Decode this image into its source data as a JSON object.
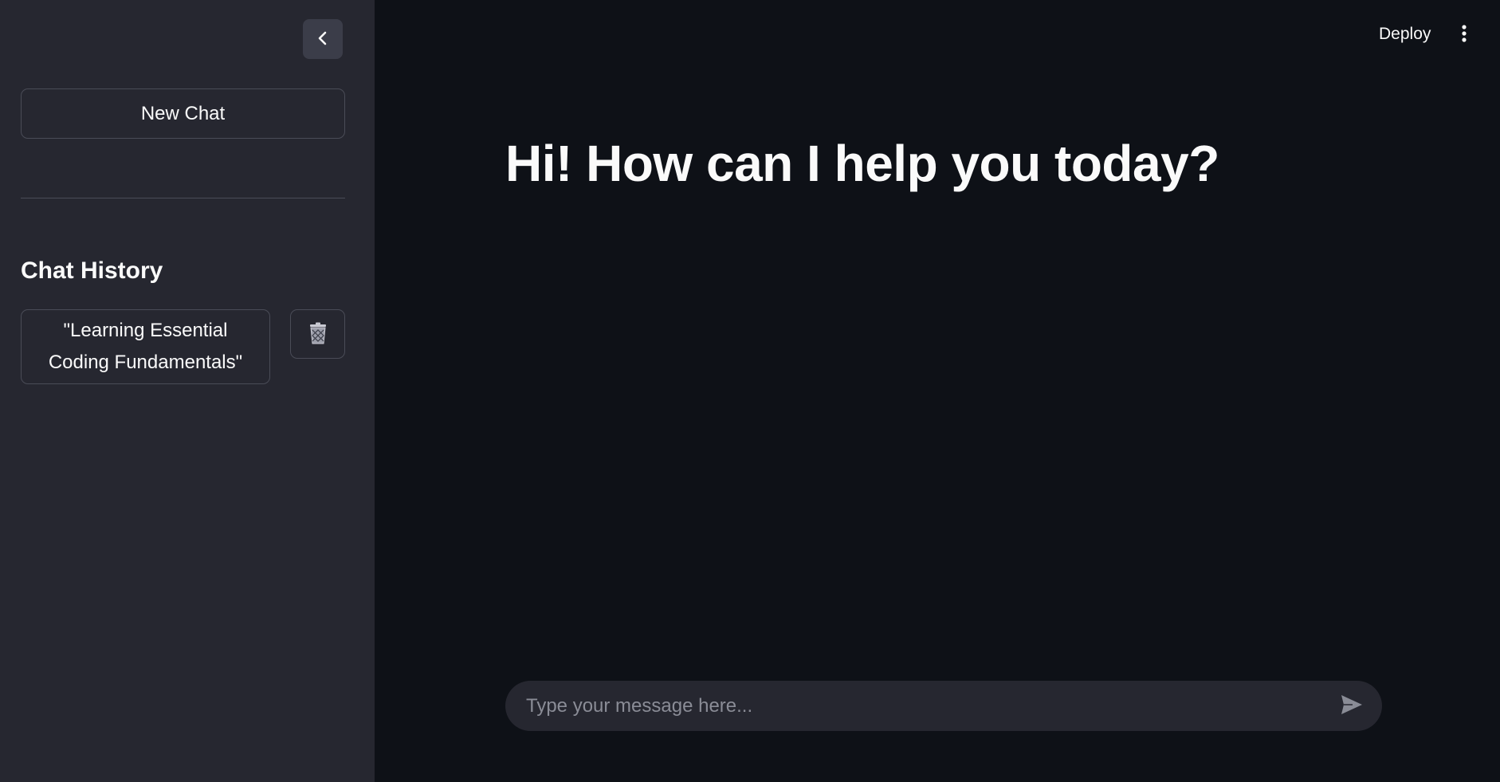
{
  "sidebar": {
    "collapse_icon": "chevron-left-icon",
    "new_chat_label": "New Chat",
    "history_title": "Chat History",
    "history_items": [
      {
        "label": "\"Learning Essential Coding Fundamentals\"",
        "delete_icon": "trash-icon"
      }
    ]
  },
  "header": {
    "deploy_label": "Deploy",
    "menu_icon": "vertical-ellipsis-icon"
  },
  "main": {
    "greeting": "Hi! How can I help you today?",
    "chat_input": {
      "value": "",
      "placeholder": "Type your message here...",
      "send_icon": "send-arrow-icon"
    }
  },
  "colors": {
    "main_background": "#0e1117",
    "sidebar_background": "#262730",
    "text": "#fafafa",
    "placeholder": "#8a8c96",
    "border": "#4a4c57"
  }
}
